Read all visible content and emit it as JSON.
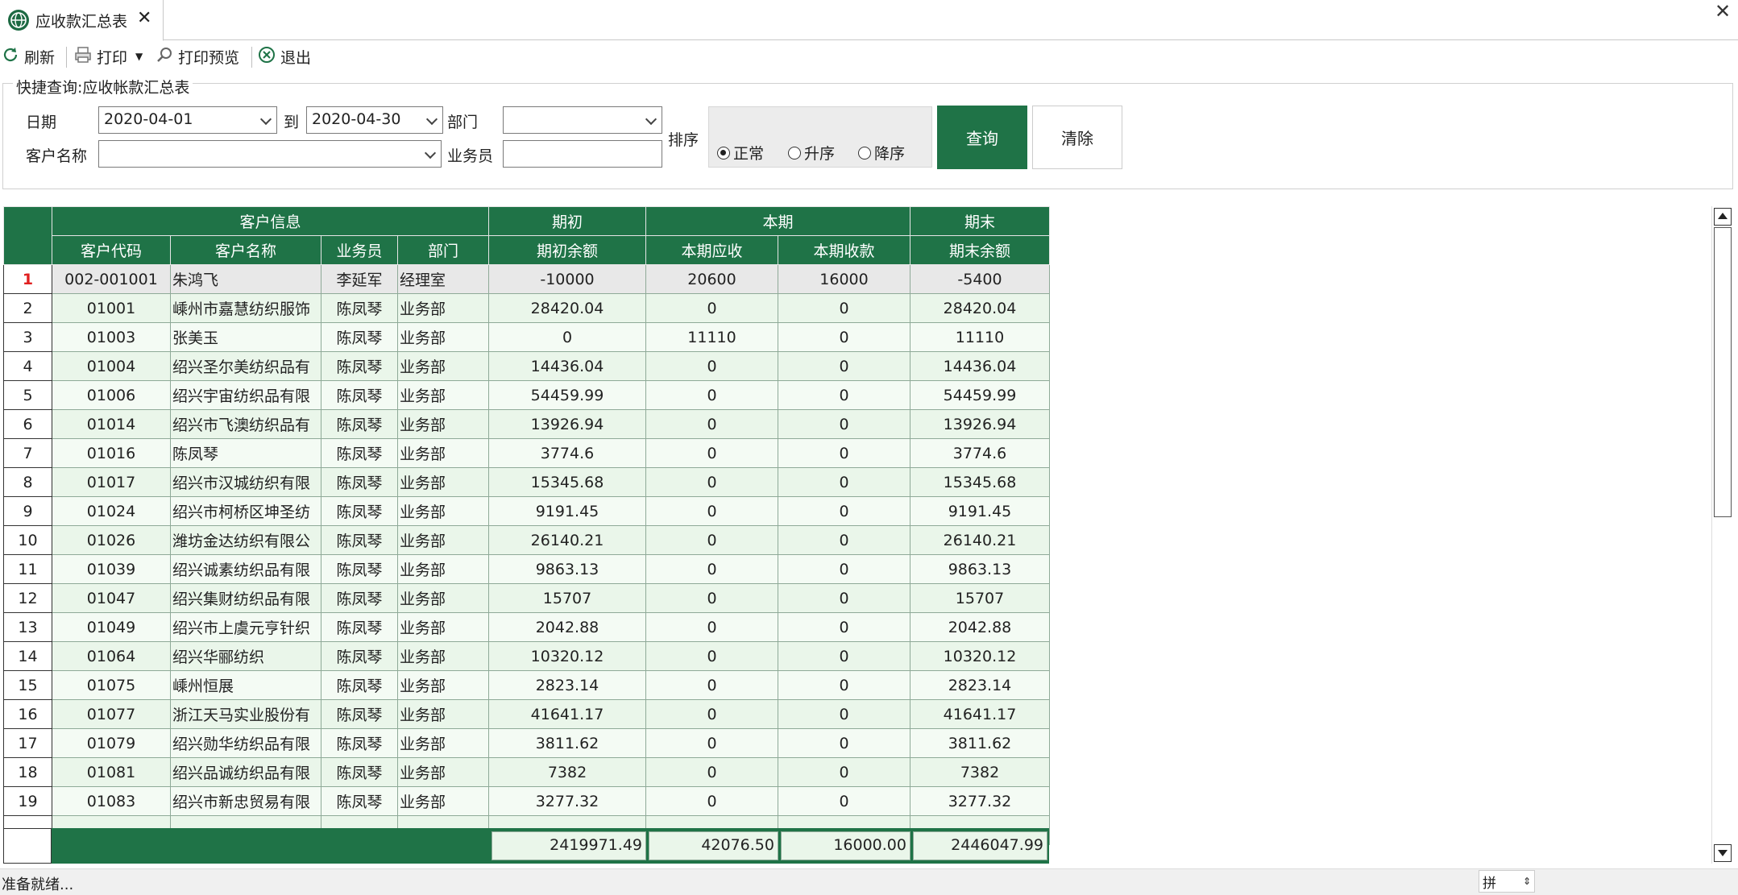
{
  "tab": {
    "title": "应收款汇总表",
    "icon": "globe-icon"
  },
  "toolbar": {
    "refresh": "刷新",
    "print": "打印",
    "print_preview": "打印预览",
    "exit": "退出"
  },
  "query": {
    "legend": "快捷查询:应收帐款汇总表",
    "date_label": "日期",
    "date_from": "2020-04-01",
    "to_label": "到",
    "date_to": "2020-04-30",
    "dept_label": "部门",
    "dept_value": "",
    "customer_label": "客户名称",
    "customer_value": "",
    "salesman_label": "业务员",
    "salesman_value": "",
    "sort_label": "排序",
    "sort_options": [
      "正常",
      "升序",
      "降序"
    ],
    "sort_selected": "正常",
    "query_btn": "查询",
    "clear_btn": "清除"
  },
  "grid": {
    "groups": [
      "客户信息",
      "期初",
      "本期",
      "期末"
    ],
    "columns": [
      "客户代码",
      "客户名称",
      "业务员",
      "部门",
      "期初余额",
      "本期应收",
      "本期收款",
      "期末余额"
    ],
    "rows": [
      [
        "1",
        "002-001001",
        "朱鸿飞",
        "李延军",
        "经理室",
        "-10000",
        "20600",
        "16000",
        "-5400"
      ],
      [
        "2",
        "01001",
        "嵊州市嘉慧纺织服饰",
        "陈凤琴",
        "业务部",
        "28420.04",
        "0",
        "0",
        "28420.04"
      ],
      [
        "3",
        "01003",
        "张美玉",
        "陈凤琴",
        "业务部",
        "0",
        "11110",
        "0",
        "11110"
      ],
      [
        "4",
        "01004",
        "绍兴圣尔美纺织品有",
        "陈凤琴",
        "业务部",
        "14436.04",
        "0",
        "0",
        "14436.04"
      ],
      [
        "5",
        "01006",
        "绍兴宇宙纺织品有限",
        "陈凤琴",
        "业务部",
        "54459.99",
        "0",
        "0",
        "54459.99"
      ],
      [
        "6",
        "01014",
        "绍兴市飞澳纺织品有",
        "陈凤琴",
        "业务部",
        "13926.94",
        "0",
        "0",
        "13926.94"
      ],
      [
        "7",
        "01016",
        "陈凤琴",
        "陈凤琴",
        "业务部",
        "3774.6",
        "0",
        "0",
        "3774.6"
      ],
      [
        "8",
        "01017",
        "绍兴市汉城纺织有限",
        "陈凤琴",
        "业务部",
        "15345.68",
        "0",
        "0",
        "15345.68"
      ],
      [
        "9",
        "01024",
        "绍兴市柯桥区坤圣纺",
        "陈凤琴",
        "业务部",
        "9191.45",
        "0",
        "0",
        "9191.45"
      ],
      [
        "10",
        "01026",
        "潍坊金达纺织有限公",
        "陈凤琴",
        "业务部",
        "26140.21",
        "0",
        "0",
        "26140.21"
      ],
      [
        "11",
        "01039",
        "绍兴诚素纺织品有限",
        "陈凤琴",
        "业务部",
        "9863.13",
        "0",
        "0",
        "9863.13"
      ],
      [
        "12",
        "01047",
        "绍兴集财纺织品有限",
        "陈凤琴",
        "业务部",
        "15707",
        "0",
        "0",
        "15707"
      ],
      [
        "13",
        "01049",
        "绍兴市上虞元亨针织",
        "陈凤琴",
        "业务部",
        "2042.88",
        "0",
        "0",
        "2042.88"
      ],
      [
        "14",
        "01064",
        "绍兴华郦纺织",
        "陈凤琴",
        "业务部",
        "10320.12",
        "0",
        "0",
        "10320.12"
      ],
      [
        "15",
        "01075",
        "嵊州恒展",
        "陈凤琴",
        "业务部",
        "2823.14",
        "0",
        "0",
        "2823.14"
      ],
      [
        "16",
        "01077",
        "浙江天马实业股份有",
        "陈凤琴",
        "业务部",
        "41641.17",
        "0",
        "0",
        "41641.17"
      ],
      [
        "17",
        "01079",
        "绍兴勋华纺织品有限",
        "陈凤琴",
        "业务部",
        "3811.62",
        "0",
        "0",
        "3811.62"
      ],
      [
        "18",
        "01081",
        "绍兴品诚纺织品有限",
        "陈凤琴",
        "业务部",
        "7382",
        "0",
        "0",
        "7382"
      ],
      [
        "19",
        "01083",
        "绍兴市新忠贸易有限",
        "陈凤琴",
        "业务部",
        "3277.32",
        "0",
        "0",
        "3277.32"
      ]
    ],
    "totals": {
      "opening": "2419971.49",
      "receivable": "42076.50",
      "received": "16000.00",
      "closing": "2446047.99"
    }
  },
  "status": {
    "text": "准备就绪...",
    "ime": "拼"
  }
}
